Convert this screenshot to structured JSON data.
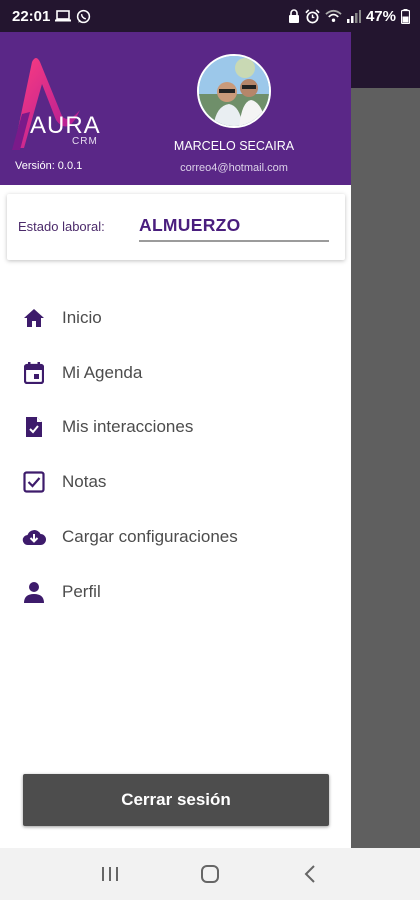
{
  "status_bar": {
    "time": "22:01",
    "battery": "47%",
    "left_icons": [
      "laptop-icon",
      "whatsapp-icon"
    ],
    "right_icons": [
      "lock-icon",
      "alarm-icon",
      "wifi-icon",
      "signal-icon",
      "battery-icon"
    ]
  },
  "header": {
    "logo_text": "AURA",
    "logo_sub": "CRM",
    "version": "Versión: 0.0.1",
    "user_name": "MARCELO SECAIRA",
    "user_email": "correo4@hotmail.com"
  },
  "work_status": {
    "label": "Estado laboral:",
    "value": "ALMUERZO"
  },
  "menu": {
    "items": [
      {
        "label": "Inicio",
        "icon": "home-icon"
      },
      {
        "label": "Mi Agenda",
        "icon": "calendar-icon"
      },
      {
        "label": "Mis interacciones",
        "icon": "document-check-icon"
      },
      {
        "label": "Notas",
        "icon": "checkbox-icon"
      },
      {
        "label": "Cargar configuraciones",
        "icon": "cloud-download-icon"
      },
      {
        "label": "Perfil",
        "icon": "person-icon"
      }
    ]
  },
  "logout": {
    "label": "Cerrar sesión"
  },
  "colors": {
    "header_bg": "#5a2787",
    "status_bar_bg": "#23152f",
    "accent_text": "#4a1e7e",
    "icon_color": "#3d1b6b",
    "logout_bg": "#4d4d4d",
    "scrim": "#5f5f5f"
  }
}
